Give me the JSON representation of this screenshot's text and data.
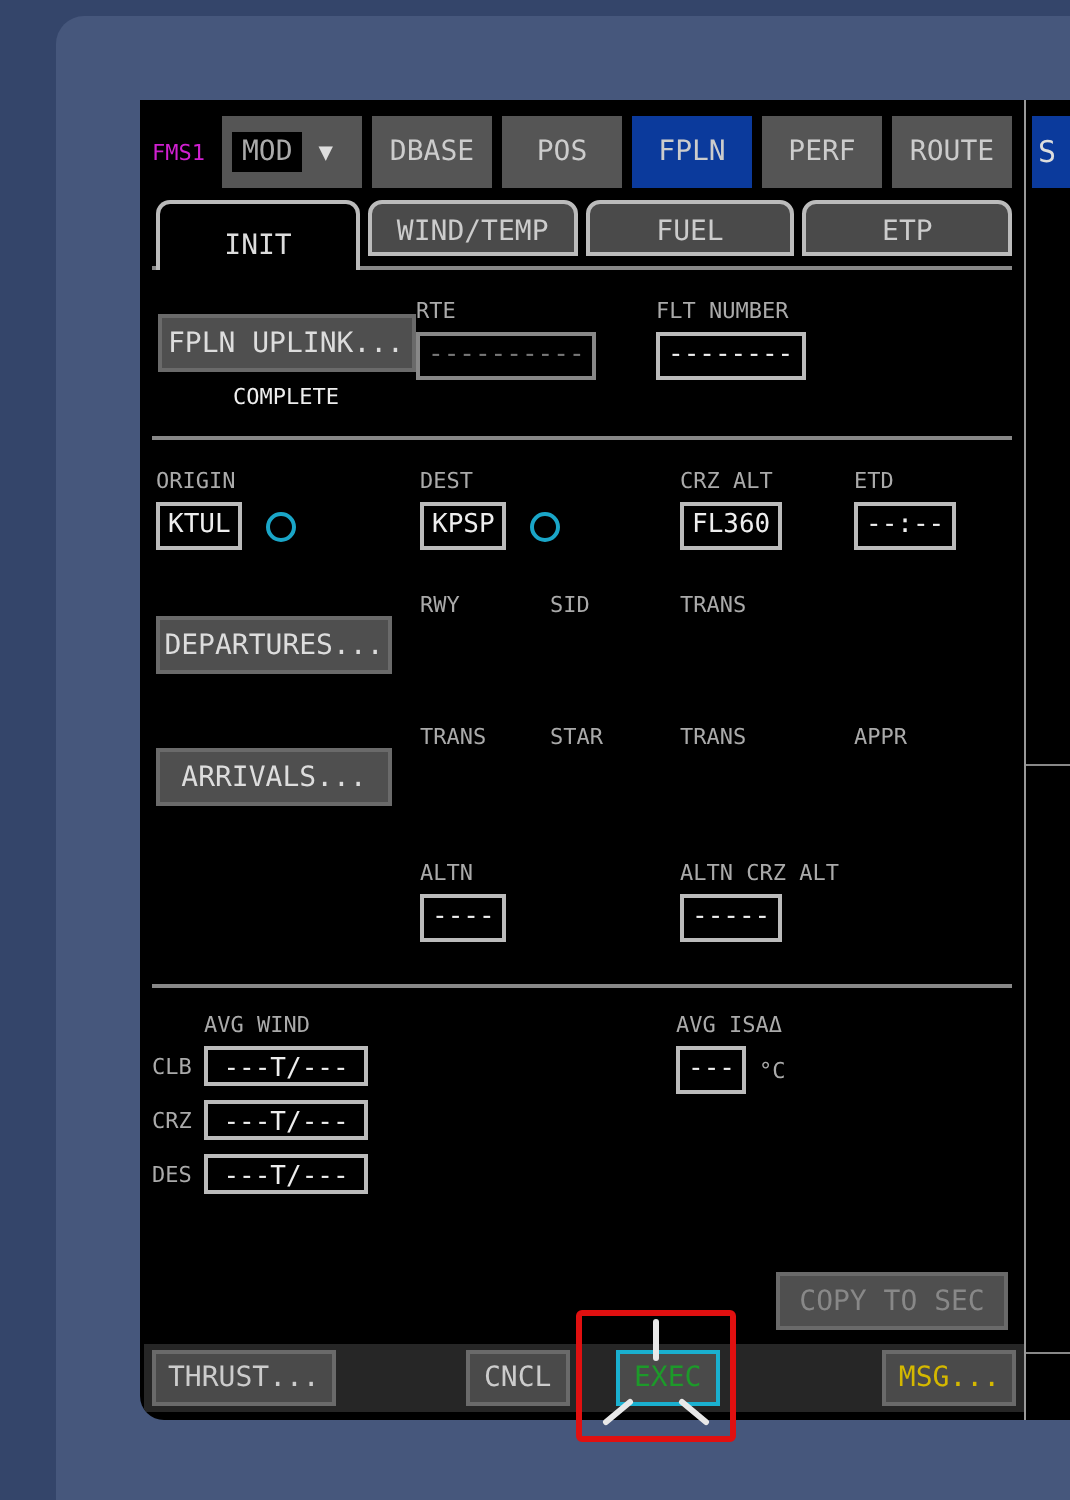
{
  "fms_label": "FMS1",
  "mode_select": {
    "value": "MOD",
    "arrow": "▼"
  },
  "page_tabs": [
    {
      "label": "DBASE",
      "selected": false
    },
    {
      "label": "POS",
      "selected": false
    },
    {
      "label": "FPLN",
      "selected": true
    },
    {
      "label": "PERF",
      "selected": false
    },
    {
      "label": "ROUTE",
      "selected": false
    }
  ],
  "side_tab": {
    "label": "S",
    "selected": true
  },
  "sub_tabs": [
    {
      "label": "INIT",
      "selected": true
    },
    {
      "label": "WIND/TEMP",
      "selected": false
    },
    {
      "label": "FUEL",
      "selected": false
    },
    {
      "label": "ETP",
      "selected": false
    }
  ],
  "uplink": {
    "button": "FPLN UPLINK...",
    "status": "COMPLETE"
  },
  "route_fields": [
    {
      "label": "RTE",
      "value": "----------",
      "disabled": true
    },
    {
      "label": "FLT NUMBER",
      "value": "--------",
      "disabled": false
    }
  ],
  "airports": [
    {
      "label": "ORIGIN",
      "value": "KTUL",
      "marker": true
    },
    {
      "label": "DEST",
      "value": "KPSP",
      "marker": true
    },
    {
      "label": "CRZ ALT",
      "value": "FL360"
    },
    {
      "label": "ETD",
      "value": "--:--"
    }
  ],
  "departure": {
    "button": "DEPARTURES...",
    "labels": [
      "RWY",
      "SID",
      "TRANS"
    ]
  },
  "arrival": {
    "button": "ARRIVALS...",
    "labels": [
      "TRANS",
      "STAR",
      "TRANS",
      "APPR"
    ]
  },
  "alternate": [
    {
      "label": "ALTN",
      "value": "----"
    },
    {
      "label": "ALTN CRZ ALT",
      "value": "-----"
    }
  ],
  "avg_wind": {
    "title": "AVG WIND",
    "rows": [
      {
        "phase": "CLB",
        "value": "---T/---"
      },
      {
        "phase": "CRZ",
        "value": "---T/---"
      },
      {
        "phase": "DES",
        "value": "---T/---"
      }
    ]
  },
  "avg_isa": {
    "title": "AVG ISAΔ",
    "value": "---",
    "unit": "°C"
  },
  "copy_button": {
    "label": "COPY TO SEC",
    "disabled": true
  },
  "bottom_buttons": [
    {
      "label": "THRUST...",
      "kind": "normal"
    },
    {
      "label": "CNCL",
      "kind": "normal"
    },
    {
      "label": "EXEC",
      "kind": "exec"
    },
    {
      "label": "MSG...",
      "kind": "message"
    }
  ]
}
